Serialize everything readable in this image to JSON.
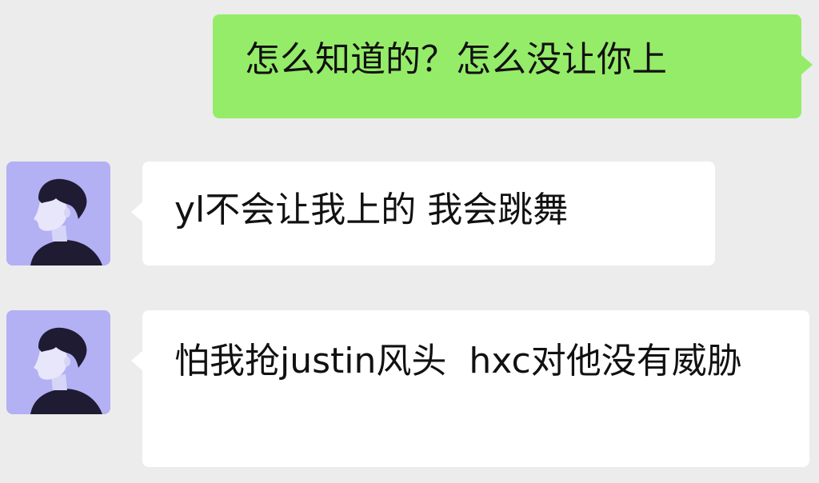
{
  "colors": {
    "background": "#ececec",
    "sent_bubble": "#95ec69",
    "received_bubble": "#ffffff",
    "avatar_bg": "#b3b0f4",
    "text": "#111111"
  },
  "messages": [
    {
      "direction": "sent",
      "text": "怎么知道的？怎么没让你上"
    },
    {
      "direction": "received",
      "avatar_icon": "person-profile-avatar",
      "text": "yl不会让我上的 我会跳舞"
    },
    {
      "direction": "received",
      "avatar_icon": "person-profile-avatar",
      "text": "怕我抢justin风头  hxc对他没有威胁"
    }
  ]
}
